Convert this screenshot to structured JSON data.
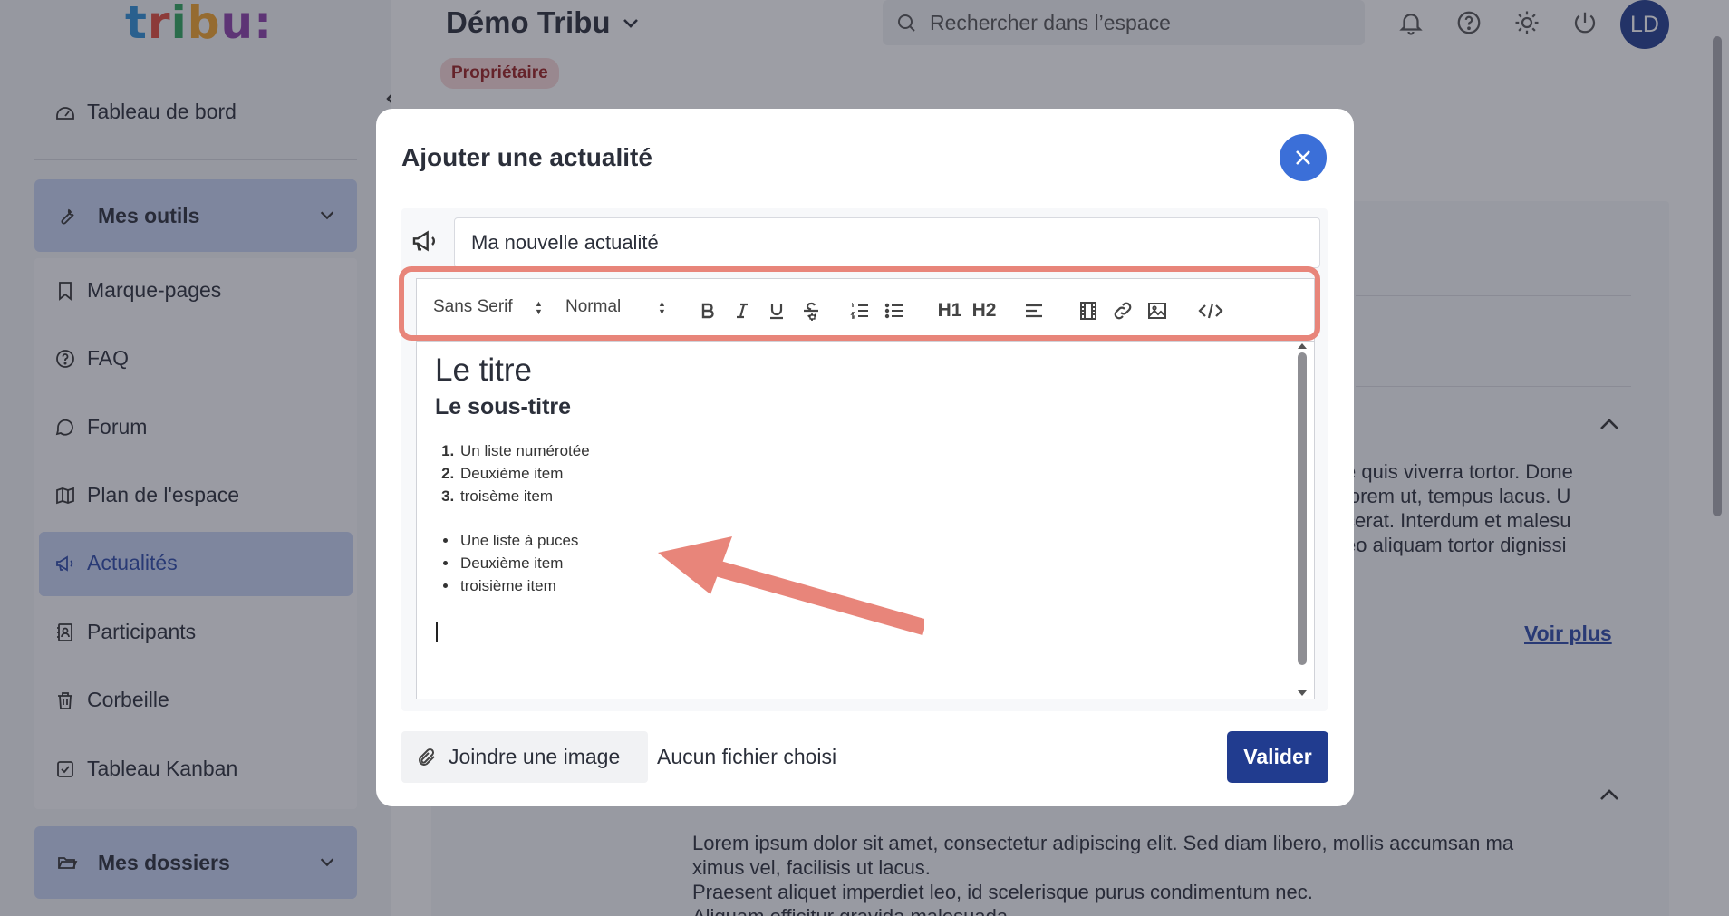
{
  "app": {
    "logo": [
      "t",
      "r",
      "i",
      "b",
      "u",
      ":"
    ],
    "logo_colors": [
      "#2f8fd5",
      "#e14b3b",
      "#2fa55c",
      "#f0a32a",
      "#8b3fa8",
      "#8b3fa8"
    ],
    "space_name": "Démo Tribu",
    "role_badge": "Propriétaire",
    "search_placeholder": "Rechercher dans l’espace",
    "avatar_initials": "LD"
  },
  "sidebar": {
    "dashboard": "Tableau de bord",
    "tools_group": "Mes outils",
    "items": [
      {
        "label": "Marque-pages",
        "icon": "bookmark-icon"
      },
      {
        "label": "FAQ",
        "icon": "help-circle-icon"
      },
      {
        "label": "Forum",
        "icon": "chat-bubble-icon"
      },
      {
        "label": "Plan de l'espace",
        "icon": "map-icon"
      },
      {
        "label": "Actualités",
        "icon": "megaphone-icon",
        "active": true
      },
      {
        "label": "Participants",
        "icon": "contacts-icon"
      },
      {
        "label": "Corbeille",
        "icon": "trash-icon"
      },
      {
        "label": "Tableau Kanban",
        "icon": "checkbox-icon"
      }
    ],
    "folders_group": "Mes dossiers"
  },
  "background": {
    "para1_lines": [
      "e quis viverra tortor. Done",
      "lorem ut, tempus lacus. U",
      "cerat. Interdum et malesu",
      "eo aliquam tortor dignissi"
    ],
    "see_more": "Voir plus",
    "para2_lines": [
      "Lorem ipsum dolor sit amet, consectetur adipiscing elit. Sed diam libero, mollis accumsan ma",
      "ximus vel, facilisis ut lacus.",
      "Praesent aliquet imperdiet leo, id scelerisque purus condimentum nec.",
      "Aliquam efficitur gravida malesuada"
    ]
  },
  "modal": {
    "title": "Ajouter une actualité",
    "title_input_value": "Ma nouvelle actualité",
    "toolbar": {
      "font_family": "Sans Serif",
      "font_size": "Normal",
      "buttons": [
        "bold",
        "italic",
        "underline",
        "strikethrough",
        "ordered-list",
        "bullet-list",
        "heading-1",
        "heading-2",
        "align",
        "video",
        "link",
        "image",
        "code"
      ],
      "h1": "H1",
      "h2": "H2"
    },
    "editor": {
      "heading1": "Le titre",
      "heading2": "Le sous-titre",
      "ordered_list": [
        "Un liste numérotée",
        "Deuxième item",
        "troisème item"
      ],
      "bullet_list": [
        "Une liste à puces",
        "Deuxième item",
        "troisième item"
      ]
    },
    "attach_label": "Joindre une image",
    "no_file_label": "Aucun fichier choisi",
    "submit_label": "Valider"
  },
  "colors": {
    "accent": "#213c8f",
    "close_button": "#3b6fd8",
    "highlight": "#e8857a"
  }
}
